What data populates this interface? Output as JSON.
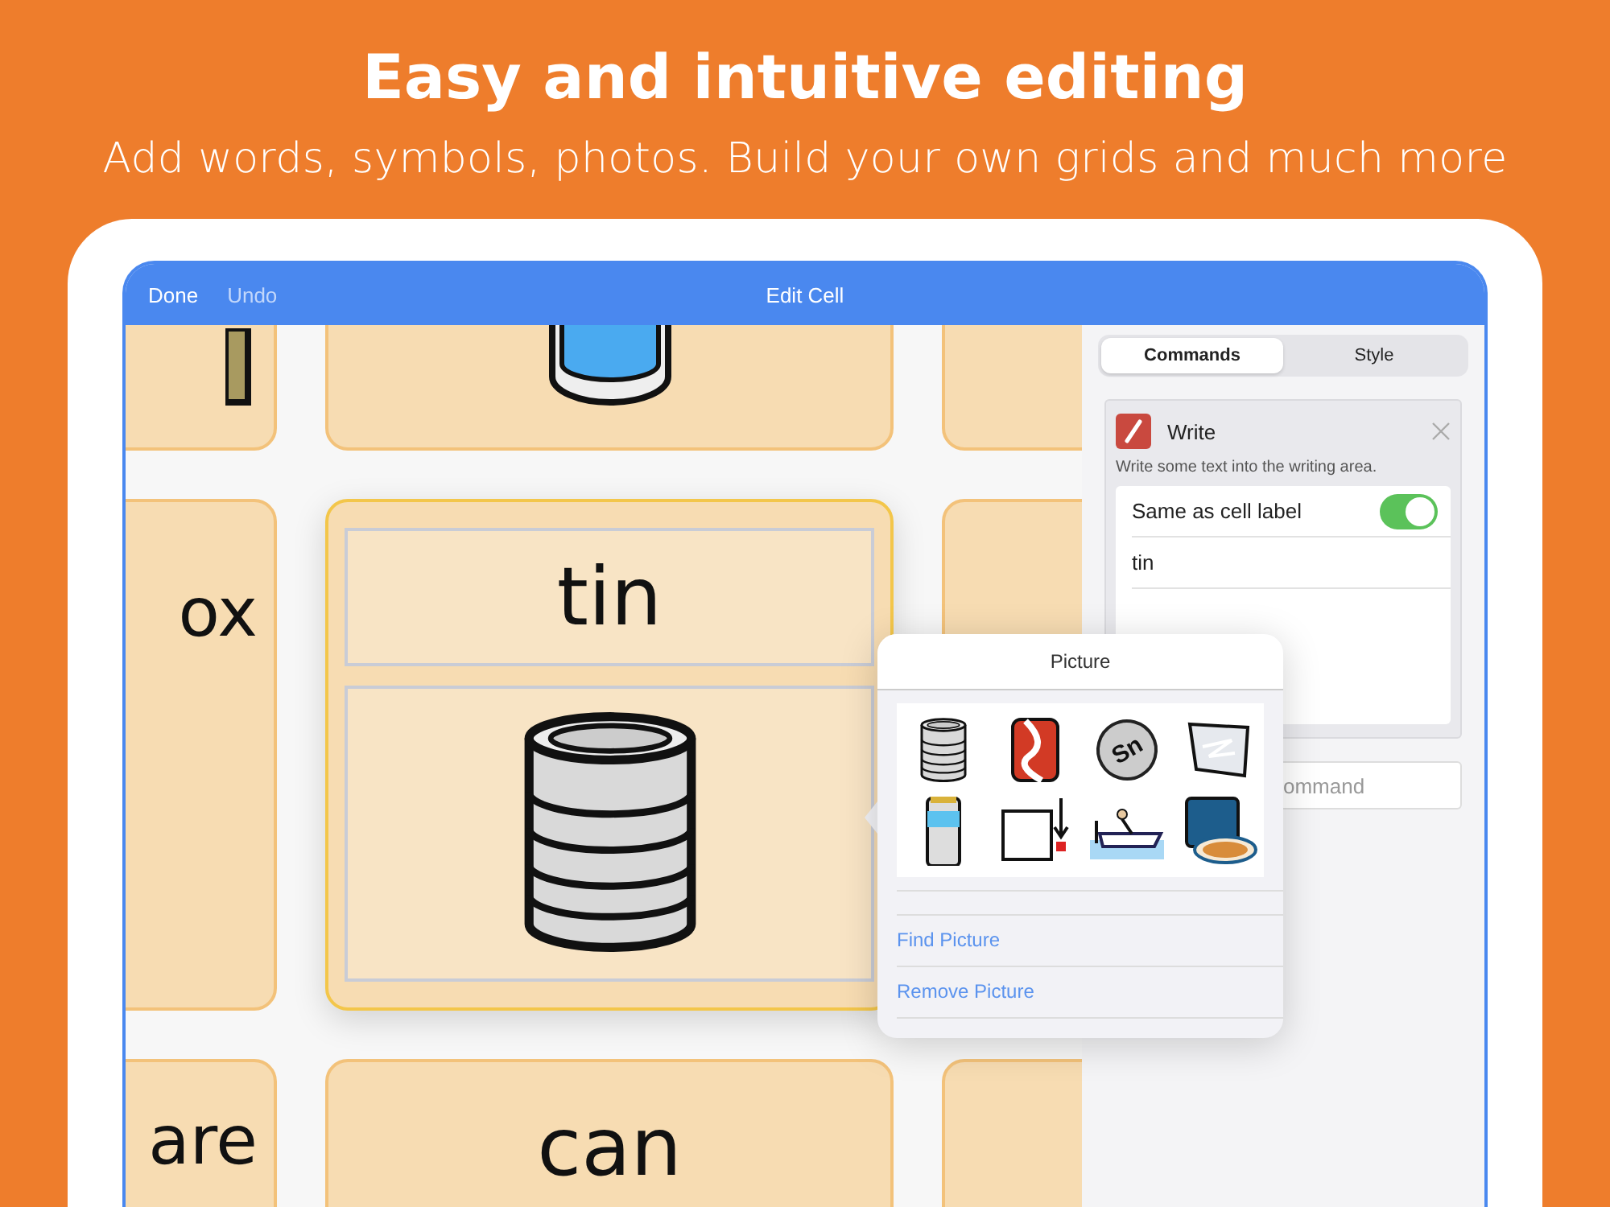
{
  "headline": "Easy and intuitive editing",
  "subheadline": "Add words, symbols, photos. Build your own grids and much more",
  "nav_bar": {
    "buttons": [
      {
        "label": "Done",
        "disabled": false
      },
      {
        "label": "Undo",
        "disabled": true
      }
    ],
    "title": "Edit Cell"
  },
  "grid_cells": [
    {
      "kind": "symbol",
      "selected": false
    },
    {
      "kind": "symbol",
      "selected": false
    },
    {
      "kind": "blank",
      "selected": false
    },
    {
      "kind": "word",
      "label": "ox",
      "selected": false
    },
    {
      "kind": "edit",
      "label": "tin",
      "selected": true
    },
    {
      "kind": "blank",
      "selected": false
    },
    {
      "kind": "word",
      "label": "are",
      "selected": false
    },
    {
      "kind": "word",
      "label": "can",
      "selected": false
    },
    {
      "kind": "blank",
      "selected": false
    }
  ],
  "panel": {
    "tabs": [
      {
        "label": "Commands",
        "selected": true
      },
      {
        "label": "Style",
        "selected": false
      }
    ],
    "command": {
      "title": "Write",
      "description": "Write some text into the writing area.",
      "toggle": {
        "label": "Same as cell label",
        "on": true
      },
      "text": "tin"
    },
    "add_command_field": {
      "placeholder": "ommand"
    }
  },
  "popover": {
    "title": "Picture",
    "coin_symbol": "Sn",
    "actions": [
      "Find Picture",
      "Remove Picture"
    ]
  }
}
